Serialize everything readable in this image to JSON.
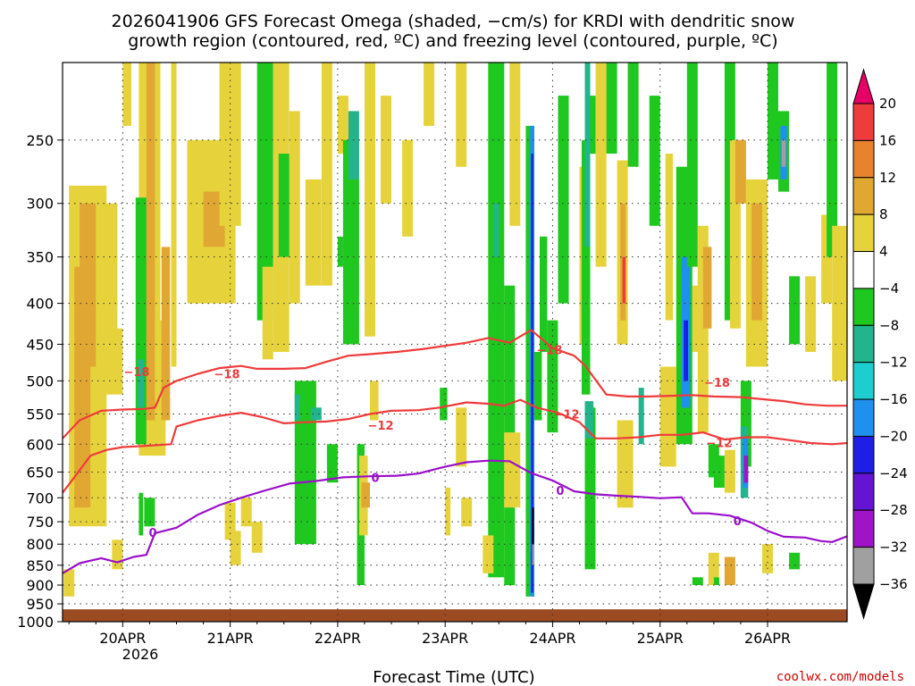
{
  "chart_data": {
    "type": "heatmap",
    "title_line1": "2026041906 GFS Forecast Omega (shaded, −cm/s) for KRDI with dendritic snow",
    "title_line2": "growth region (contoured, red, ºC) and freezing level (contoured, purple, ºC)",
    "xlabel": "Forecast Time (UTC)",
    "credit": "coolwx.com/models",
    "x_ticks": [
      "20APR",
      "21APR",
      "22APR",
      "23APR",
      "24APR",
      "25APR",
      "26APR"
    ],
    "x_tick_year": "2026",
    "x_range_days": [
      -0.56,
      6.74
    ],
    "y_ticks": [
      250,
      300,
      350,
      400,
      450,
      500,
      550,
      600,
      650,
      700,
      750,
      800,
      850,
      900,
      950,
      1000
    ],
    "ylim_hpa": [
      200,
      1000
    ],
    "y_scale": "log-pressure",
    "grid": true,
    "colorbar": {
      "labels": [
        "20",
        "16",
        "12",
        "8",
        "4",
        "−4",
        "−8",
        "−12",
        "−16",
        "−20",
        "−24",
        "−28",
        "−32",
        "−36"
      ],
      "colors": [
        "#e60066",
        "#ee3b3b",
        "#e8822c",
        "#e0a832",
        "#e6d33c",
        "#ffffff",
        "#1ec81e",
        "#22b48c",
        "#1ecdcd",
        "#2090ee",
        "#1e1ee6",
        "#6414d2",
        "#a014c8",
        "#a0a0a0",
        "#000000"
      ]
    },
    "ground_color": "#9b4a22",
    "contours": [
      {
        "label": "−18",
        "color": "#ee3b3b",
        "label_pos": [
          [
            0.13,
            487
          ],
          [
            0.97,
            490
          ],
          [
            3.97,
            457
          ],
          [
            5.53,
            502
          ]
        ],
        "points": [
          [
            -0.56,
            590
          ],
          [
            -0.4,
            560
          ],
          [
            -0.2,
            545
          ],
          [
            0.0,
            543
          ],
          [
            0.2,
            542
          ],
          [
            0.3,
            540
          ],
          [
            0.38,
            510
          ],
          [
            0.5,
            500
          ],
          [
            0.7,
            490
          ],
          [
            0.9,
            482
          ],
          [
            1.1,
            479
          ],
          [
            1.25,
            483
          ],
          [
            1.5,
            483
          ],
          [
            1.7,
            482
          ],
          [
            1.9,
            473
          ],
          [
            2.1,
            465
          ],
          [
            2.3,
            463
          ],
          [
            2.55,
            460
          ],
          [
            2.8,
            456
          ],
          [
            3.0,
            452
          ],
          [
            3.2,
            448
          ],
          [
            3.4,
            442
          ],
          [
            3.6,
            448
          ],
          [
            3.8,
            432
          ],
          [
            4.0,
            455
          ],
          [
            4.2,
            465
          ],
          [
            4.3,
            478
          ],
          [
            4.5,
            520
          ],
          [
            4.7,
            523
          ],
          [
            4.9,
            523
          ],
          [
            5.1,
            522
          ],
          [
            5.3,
            521
          ],
          [
            5.5,
            523
          ],
          [
            5.75,
            524
          ],
          [
            5.95,
            527
          ],
          [
            6.15,
            530
          ],
          [
            6.35,
            535
          ],
          [
            6.55,
            537
          ],
          [
            6.74,
            537
          ]
        ]
      },
      {
        "label": "−12",
        "color": "#ee3b3b",
        "label_pos": [
          [
            2.4,
            568
          ],
          [
            4.13,
            550
          ],
          [
            5.55,
            597
          ]
        ],
        "points": [
          [
            -0.56,
            690
          ],
          [
            -0.45,
            660
          ],
          [
            -0.3,
            620
          ],
          [
            -0.15,
            610
          ],
          [
            0.0,
            605
          ],
          [
            0.2,
            603
          ],
          [
            0.45,
            600
          ],
          [
            0.5,
            570
          ],
          [
            0.7,
            560
          ],
          [
            0.9,
            553
          ],
          [
            1.1,
            548
          ],
          [
            1.3,
            555
          ],
          [
            1.5,
            565
          ],
          [
            1.7,
            563
          ],
          [
            1.9,
            562
          ],
          [
            2.1,
            558
          ],
          [
            2.3,
            550
          ],
          [
            2.5,
            545
          ],
          [
            2.75,
            544
          ],
          [
            2.95,
            540
          ],
          [
            3.2,
            532
          ],
          [
            3.4,
            534
          ],
          [
            3.55,
            537
          ],
          [
            3.7,
            528
          ],
          [
            3.85,
            540
          ],
          [
            4.05,
            548
          ],
          [
            4.25,
            563
          ],
          [
            4.4,
            590
          ],
          [
            4.6,
            590
          ],
          [
            4.8,
            588
          ],
          [
            5.0,
            584
          ],
          [
            5.2,
            584
          ],
          [
            5.4,
            580
          ],
          [
            5.6,
            592
          ],
          [
            5.8,
            588
          ],
          [
            6.0,
            588
          ],
          [
            6.2,
            593
          ],
          [
            6.4,
            598
          ],
          [
            6.6,
            600
          ],
          [
            6.74,
            598
          ]
        ]
      },
      {
        "label": "0",
        "color": "#9a10c8",
        "label_pos": [
          [
            0.28,
            773
          ],
          [
            2.35,
            660
          ],
          [
            4.07,
            685
          ],
          [
            5.72,
            748
          ]
        ],
        "points": [
          [
            -0.56,
            870
          ],
          [
            -0.4,
            845
          ],
          [
            -0.2,
            833
          ],
          [
            -0.05,
            843
          ],
          [
            0.1,
            830
          ],
          [
            0.22,
            825
          ],
          [
            0.3,
            775
          ],
          [
            0.5,
            763
          ],
          [
            0.7,
            735
          ],
          [
            0.9,
            715
          ],
          [
            1.1,
            700
          ],
          [
            1.3,
            687
          ],
          [
            1.55,
            672
          ],
          [
            1.8,
            667
          ],
          [
            2.05,
            660
          ],
          [
            2.3,
            658
          ],
          [
            2.55,
            657
          ],
          [
            2.75,
            653
          ],
          [
            3.0,
            640
          ],
          [
            3.2,
            632
          ],
          [
            3.4,
            629
          ],
          [
            3.6,
            630
          ],
          [
            3.8,
            652
          ],
          [
            4.0,
            666
          ],
          [
            4.2,
            687
          ],
          [
            4.4,
            693
          ],
          [
            4.6,
            696
          ],
          [
            4.8,
            698
          ],
          [
            5.0,
            701
          ],
          [
            5.2,
            699
          ],
          [
            5.3,
            732
          ],
          [
            5.45,
            732
          ],
          [
            5.65,
            737
          ],
          [
            5.85,
            752
          ],
          [
            6.0,
            770
          ],
          [
            6.15,
            783
          ],
          [
            6.35,
            785
          ],
          [
            6.5,
            793
          ],
          [
            6.6,
            795
          ],
          [
            6.74,
            782
          ]
        ]
      }
    ]
  }
}
